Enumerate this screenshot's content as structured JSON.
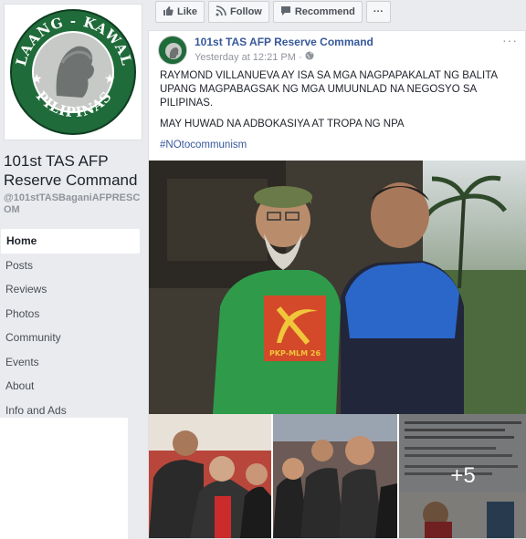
{
  "page": {
    "logo_top_text": "LAANG - KAWAL",
    "logo_bottom_text": "PILIPINAS",
    "name": "101st TAS AFP Reserve Command",
    "handle": "@101stTASBaganiAFPRESCOM"
  },
  "nav": {
    "items": [
      {
        "label": "Home"
      },
      {
        "label": "Posts"
      },
      {
        "label": "Reviews"
      },
      {
        "label": "Photos"
      },
      {
        "label": "Community"
      },
      {
        "label": "Events"
      },
      {
        "label": "About"
      },
      {
        "label": "Info and Ads"
      }
    ]
  },
  "actions": {
    "like": "Like",
    "follow": "Follow",
    "recommend": "Recommend",
    "more": "···"
  },
  "post": {
    "author": "101st TAS AFP Reserve Command",
    "time": "Yesterday at 12:21 PM ·",
    "menu": "···",
    "para1": "RAYMOND VILLANUEVA AY ISA SA MGA NAGPAPAKALAT NG BALITA UPANG MAGPABAGSAK NG MGA UMUUNLAD NA NEGOSYO SA PILIPINAS.",
    "para2": "MAY HUWAD NA ADBOKASIYA AT TROPA NG NPA",
    "hashtag": "#NOtocommunism",
    "shirt_text": "PKP-MLM 26",
    "more_photos": "+5"
  },
  "colors": {
    "link": "#365899",
    "logo_green": "#1f6b3a",
    "shirt_green": "#2e9a4a",
    "shirt_blue": "#2a67c9"
  }
}
